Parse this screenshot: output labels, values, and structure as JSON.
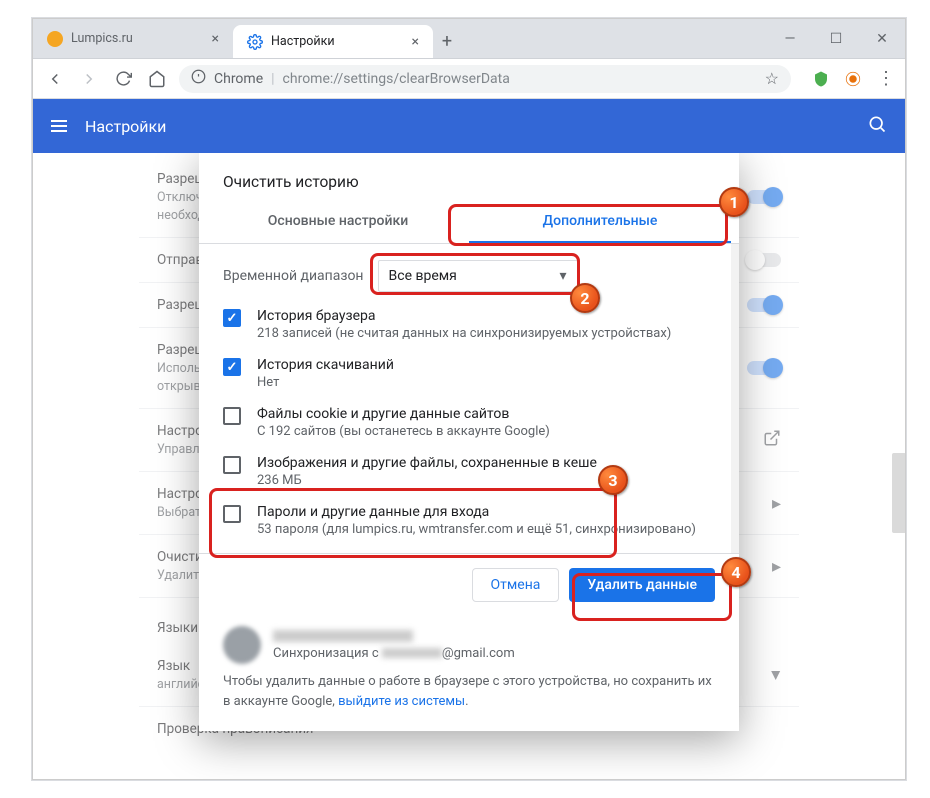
{
  "tabs": [
    {
      "title": "Lumpics.ru"
    },
    {
      "title": "Настройки"
    }
  ],
  "addressbar": {
    "chrome_label": "Chrome",
    "url_display": "chrome://settings/clearBrowserData"
  },
  "settings_header": {
    "title": "Настройки"
  },
  "bg_rows": {
    "r1_title": "Разрешить",
    "r1_sub1": "Отключите",
    "r1_sub2": "необходим",
    "r2_title": "Отправлять",
    "r3_title": "Разрешить",
    "r4_title": "Разрешить",
    "r4_sub1": "Использов",
    "r4_sub2": "открывает",
    "r5_title": "Настройки",
    "r5_sub": "Управлени",
    "r6_title": "Настройки",
    "r6_sub": "Выбрать,",
    "r7_title": "Очистить",
    "r7_sub": "Удалить ф",
    "section_lang": "Языки",
    "r8_title": "Язык",
    "r8_sub": "английски",
    "r9_title": "Проверка правописания"
  },
  "dialog": {
    "title": "Очистить историю",
    "tab_basic": "Основные настройки",
    "tab_advanced": "Дополнительные",
    "time_label": "Временной диапазон",
    "time_value": "Все время",
    "chk1_t": "История браузера",
    "chk1_s": "218 записей (не считая данных на синхронизируемых устройствах)",
    "chk2_t": "История скачиваний",
    "chk2_s": "Нет",
    "chk3_t": "Файлы cookie и другие данные сайтов",
    "chk3_s": "С 192 сайтов (вы останетесь в аккаунте Google)",
    "chk4_t": "Изображения и другие файлы, сохраненные в кеше",
    "chk4_s": "236 МБ",
    "chk5_t": "Пароли и другие данные для входа",
    "chk5_s": "53 пароля (для lumpics.ru, wmtransfer.com и ещё 51, синхронизировано)",
    "btn_cancel": "Отмена",
    "btn_clear": "Удалить данные",
    "acct_sync": "Синхронизация с",
    "acct_mail_suffix": "@gmail.com",
    "foot_text_1": "Чтобы удалить данные о работе в браузере с этого устройства, но сохранить их в аккаунте Google, ",
    "foot_link": "выйдите из системы",
    "foot_text_2": "."
  },
  "badges": {
    "b1": "1",
    "b2": "2",
    "b3": "3",
    "b4": "4"
  }
}
